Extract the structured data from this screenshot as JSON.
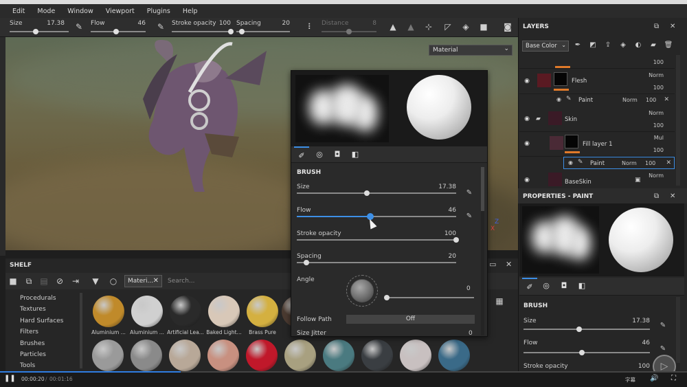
{
  "menu": [
    "Edit",
    "Mode",
    "Window",
    "Viewport",
    "Plugins",
    "Help"
  ],
  "toolbar": {
    "params": [
      {
        "label": "Size",
        "value": "17.38",
        "position": 0.44
      },
      {
        "label": "Flow",
        "value": "46",
        "position": 0.46
      },
      {
        "label": "Stroke opacity",
        "value": "100",
        "position": 1.0
      },
      {
        "label": "Spacing",
        "value": "20",
        "position": 0.1
      },
      {
        "label": "Distance",
        "value": "8",
        "position": 0.5,
        "disabled": true
      }
    ]
  },
  "viewport": {
    "material_mode": "Material",
    "axis_x": "X",
    "axis_z": "Z"
  },
  "shelf": {
    "title": "SHELF",
    "filter_tag": "Materi...",
    "search_placeholder": "Search...",
    "categories": [
      "Procedurals",
      "Textures",
      "Hard Surfaces",
      "Filters",
      "Brushes",
      "Particles",
      "Tools"
    ],
    "materials": [
      "Aluminium ...",
      "Aluminium ...",
      "Artificial Lea...",
      "Baked Light...",
      "Brass Pure",
      ""
    ],
    "material_colors": [
      "#c08a2a",
      "#d0d0d0",
      "#2a2a2a",
      "#d8c8b8",
      "#d4b040",
      "#4a3a30"
    ],
    "row2_colors": [
      "#9a9a9a",
      "#8a8a8a",
      "#b8a898",
      "#c89080",
      "#c0182a",
      "#a8a080",
      "#4a7a80",
      "#3a3e42",
      "#c8c0c0",
      "#3a6a88"
    ]
  },
  "brush_popup": {
    "section": "BRUSH",
    "params": [
      {
        "label": "Size",
        "value": "17.38",
        "position": 0.44
      },
      {
        "label": "Flow",
        "value": "46",
        "position": 0.46,
        "active": true
      },
      {
        "label": "Stroke opacity",
        "value": "100",
        "position": 1.0
      },
      {
        "label": "Spacing",
        "value": "20",
        "position": 0.06
      }
    ],
    "angle_label": "Angle",
    "angle_value": "0",
    "follow_path_label": "Follow Path",
    "follow_path_value": "Off",
    "size_jitter_label": "Size Jitter",
    "size_jitter_value": "0"
  },
  "layers": {
    "title": "LAYERS",
    "channel": "Base Color",
    "rows": [
      {
        "name": "",
        "blend": "",
        "opacity": "100",
        "type": "partial"
      },
      {
        "name": "Flesh",
        "blend": "Norm",
        "opacity": "100",
        "type": "layer",
        "thumb": "#5a1a22"
      },
      {
        "name": "Paint",
        "blend": "Norm",
        "opacity": "100",
        "type": "sub"
      },
      {
        "name": "Skin",
        "blend": "Norm",
        "opacity": "100",
        "type": "folder",
        "thumb": "#3a1a26"
      },
      {
        "name": "Fill layer 1",
        "blend": "Mul",
        "opacity": "100",
        "type": "layer",
        "thumb": "#4a2a36"
      },
      {
        "name": "Paint",
        "blend": "Norm",
        "opacity": "100",
        "type": "sub",
        "selected": true
      },
      {
        "name": "BaseSkin",
        "blend": "Norm",
        "opacity": "",
        "type": "layer",
        "thumb": "#3a1a26"
      }
    ]
  },
  "properties": {
    "title": "PROPERTIES - PAINT",
    "section": "BRUSH",
    "params": [
      {
        "label": "Size",
        "value": "17.38",
        "position": 0.44
      },
      {
        "label": "Flow",
        "value": "46",
        "position": 0.46
      },
      {
        "label": "Stroke opacity",
        "value": "100",
        "position": 1.0
      }
    ]
  },
  "player": {
    "current_time": "00:00:20",
    "total_time": "00:01:16",
    "subtitle_label": "字幕",
    "progress": 0.263
  }
}
